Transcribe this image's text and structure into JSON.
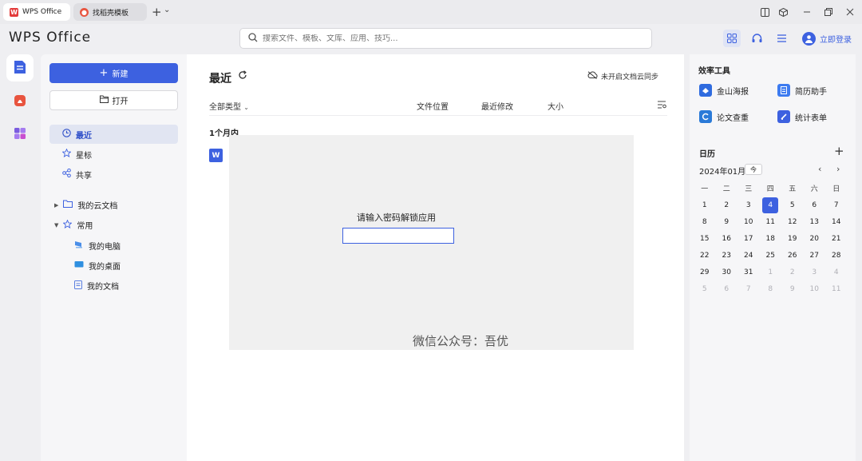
{
  "titlebar": {
    "tabs": [
      {
        "label": "WPS Office"
      },
      {
        "label": "找稻壳模板"
      }
    ],
    "add_tab": "+",
    "tab_menu": "⌄"
  },
  "header": {
    "brand": "WPS Office",
    "search_placeholder": "搜索文件、模板、文库、应用、技巧...",
    "login_label": "立即登录"
  },
  "nav": {
    "new_label": "新建",
    "open_label": "打开",
    "items": [
      {
        "label": "最近"
      },
      {
        "label": "星标"
      },
      {
        "label": "共享"
      }
    ],
    "cloud_docs": "我的云文档",
    "common": "常用",
    "common_items": [
      {
        "label": "我的电脑"
      },
      {
        "label": "我的桌面"
      },
      {
        "label": "我的文档"
      }
    ]
  },
  "main": {
    "title": "最近",
    "cloud_sync": "未开启文档云同步",
    "filter": "全部类型",
    "columns": [
      "文件位置",
      "最近修改",
      "大小"
    ],
    "group": "1个月内",
    "file_icon": "W",
    "password_prompt": "请输入密码解锁应用",
    "password_value": "",
    "watermark": "微信公众号：吾优"
  },
  "right": {
    "tools_title": "效率工具",
    "tools": [
      {
        "label": "金山海报",
        "color": "#2f6bdf"
      },
      {
        "label": "简历助手",
        "color": "#3d7bf0"
      },
      {
        "label": "论文查重",
        "color": "#2a7ad8"
      },
      {
        "label": "统计表单",
        "color": "#3d61e0"
      }
    ],
    "calendar_title": "日历",
    "month": "2024年01月",
    "today_label": "今",
    "weekdays": [
      "一",
      "二",
      "三",
      "四",
      "五",
      "六",
      "日"
    ],
    "days": [
      [
        "1",
        "2",
        "3",
        "4",
        "5",
        "6",
        "7"
      ],
      [
        "8",
        "9",
        "10",
        "11",
        "12",
        "13",
        "14"
      ],
      [
        "15",
        "16",
        "17",
        "18",
        "19",
        "20",
        "21"
      ],
      [
        "22",
        "23",
        "24",
        "25",
        "26",
        "27",
        "28"
      ],
      [
        "29",
        "30",
        "31",
        "1",
        "2",
        "3",
        "4"
      ],
      [
        "5",
        "6",
        "7",
        "8",
        "9",
        "10",
        "11"
      ]
    ],
    "today": "4"
  },
  "colors": {
    "accent": "#3d61e0",
    "selected_nav": "#e1e5f2"
  }
}
